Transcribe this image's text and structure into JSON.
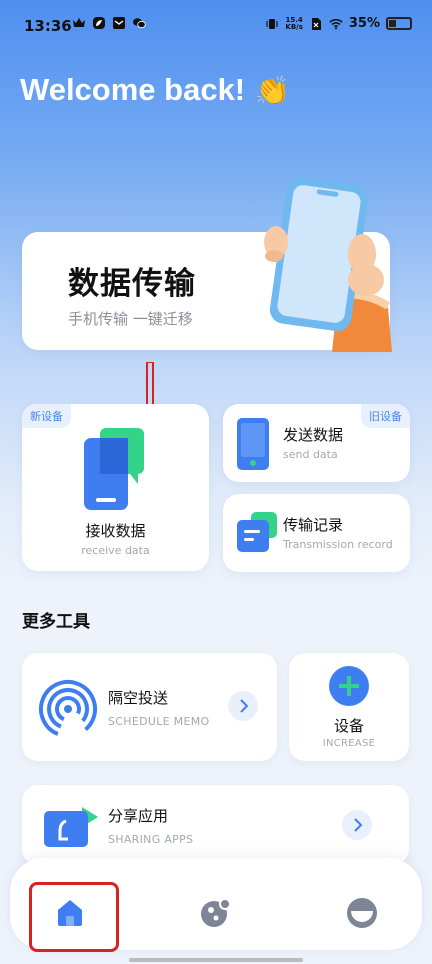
{
  "status_bar": {
    "time": "13:36",
    "net_speed_value": "15.4",
    "net_speed_unit": "KB/s",
    "battery": "35%"
  },
  "welcome": {
    "text": "Welcome back!",
    "emoji": "👏"
  },
  "hero": {
    "title": "数据传输",
    "subtitle": "手机传输 一键迁移"
  },
  "receive": {
    "tag": "新设备",
    "label": "接收数据",
    "label_en": "receive data"
  },
  "send": {
    "tag": "旧设备",
    "label": "发送数据",
    "label_en": "send data"
  },
  "record": {
    "label": "传输记录",
    "label_en": "Transmission record"
  },
  "tools": {
    "section_title": "更多工具",
    "airdrop": {
      "label": "隔空投送",
      "label_en": "SCHEDULE MEMO"
    },
    "device": {
      "label": "设备",
      "label_en": "INCREASE"
    },
    "share": {
      "label": "分享应用",
      "label_en": "SHARING APPS"
    }
  },
  "nav": {
    "items": [
      "home-icon",
      "discover-icon",
      "profile-icon"
    ],
    "active": "home-icon"
  },
  "colors": {
    "accent": "#3f7ef0",
    "green": "#33d38a",
    "highlight": "#d7231e"
  }
}
